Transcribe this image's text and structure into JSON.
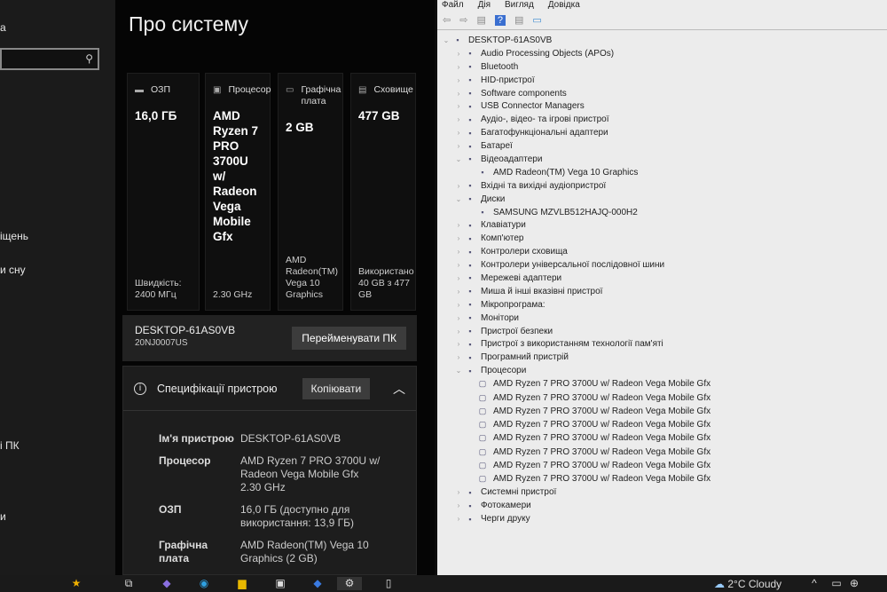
{
  "sidebar": {
    "fragments": [
      "а",
      "іщень",
      "и сну",
      "і ПК",
      "и"
    ],
    "search_icon": "search-icon"
  },
  "settings": {
    "title": "Про систему",
    "cards": [
      {
        "label": "ОЗП",
        "icon": "ram-icon",
        "value": "16,0 ГБ",
        "footer": "Швидкість: 2400 МГц"
      },
      {
        "label": "Процесор",
        "icon": "cpu-icon",
        "value": "AMD Ryzen 7 PRO 3700U w/ Radeon Vega Mobile Gfx",
        "footer": "2.30 GHz"
      },
      {
        "label": "Графічна плата",
        "icon": "gpu-icon",
        "value": "2 GB",
        "footer": "AMD Radeon(TM) Vega 10 Graphics"
      },
      {
        "label": "Сховище",
        "icon": "storage-icon",
        "value": "477 GB",
        "footer": "Використано 40 GB з 477 GB"
      }
    ],
    "device_name": "DESKTOP-61AS0VB",
    "model": "20NJ0007US",
    "rename_label": "Перейменувати ПК",
    "spec_title": "Специфікації пристрою",
    "copy_label": "Копіювати",
    "specs": [
      {
        "key": "Ім'я пристрою",
        "value": "DESKTOP-61AS0VB"
      },
      {
        "key": "Процесор",
        "value": "AMD Ryzen 7 PRO 3700U w/ Radeon Vega Mobile Gfx 2.30 GHz"
      },
      {
        "key": "ОЗП",
        "value": "16,0 ГБ (доступно для використання: 13,9 ГБ)"
      },
      {
        "key": "Графічна плата",
        "value": "AMD Radeon(TM) Vega 10 Graphics (2 GB)"
      }
    ]
  },
  "device_manager": {
    "menu": [
      "Файл",
      "Дія",
      "Вигляд",
      "Довідка"
    ],
    "tree": [
      {
        "label": "DESKTOP-61AS0VB",
        "level": 0,
        "expanded": true
      },
      {
        "label": "Audio Processing Objects (APOs)",
        "level": 1
      },
      {
        "label": "Bluetooth",
        "level": 1
      },
      {
        "label": "HID-пристрої",
        "level": 1
      },
      {
        "label": "Software components",
        "level": 1
      },
      {
        "label": "USB Connector Managers",
        "level": 1
      },
      {
        "label": "Аудіо-, відео- та ігрові пристрої",
        "level": 1
      },
      {
        "label": "Багатофункціональні адаптери",
        "level": 1
      },
      {
        "label": "Батареї",
        "level": 1
      },
      {
        "label": "Відеоадаптери",
        "level": 1,
        "expanded": true
      },
      {
        "label": "AMD Radeon(TM) Vega 10 Graphics",
        "level": 2
      },
      {
        "label": "Вхідні та вихідні аудіопристрої",
        "level": 1
      },
      {
        "label": "Диски",
        "level": 1,
        "expanded": true
      },
      {
        "label": "SAMSUNG MZVLB512HAJQ-000H2",
        "level": 2
      },
      {
        "label": "Клавіатури",
        "level": 1
      },
      {
        "label": "Комп'ютер",
        "level": 1
      },
      {
        "label": "Контролери сховища",
        "level": 1
      },
      {
        "label": "Контролери універсальної послідовної шини",
        "level": 1
      },
      {
        "label": "Мережеві адаптери",
        "level": 1
      },
      {
        "label": "Миша й інші вказівні пристрої",
        "level": 1
      },
      {
        "label": "Мікропрограма:",
        "level": 1
      },
      {
        "label": "Монітори",
        "level": 1
      },
      {
        "label": "Пристрої безпеки",
        "level": 1
      },
      {
        "label": "Пристрої з використанням технології пам'яті",
        "level": 1
      },
      {
        "label": "Програмний пристрій",
        "level": 1
      },
      {
        "label": "Процесори",
        "level": 1,
        "expanded": true
      },
      {
        "label": "AMD Ryzen 7 PRO 3700U w/ Radeon Vega Mobile Gfx",
        "level": 2
      },
      {
        "label": "AMD Ryzen 7 PRO 3700U w/ Radeon Vega Mobile Gfx",
        "level": 2
      },
      {
        "label": "AMD Ryzen 7 PRO 3700U w/ Radeon Vega Mobile Gfx",
        "level": 2
      },
      {
        "label": "AMD Ryzen 7 PRO 3700U w/ Radeon Vega Mobile Gfx",
        "level": 2
      },
      {
        "label": "AMD Ryzen 7 PRO 3700U w/ Radeon Vega Mobile Gfx",
        "level": 2
      },
      {
        "label": "AMD Ryzen 7 PRO 3700U w/ Radeon Vega Mobile Gfx",
        "level": 2
      },
      {
        "label": "AMD Ryzen 7 PRO 3700U w/ Radeon Vega Mobile Gfx",
        "level": 2
      },
      {
        "label": "AMD Ryzen 7 PRO 3700U w/ Radeon Vega Mobile Gfx",
        "level": 2
      },
      {
        "label": "Системні пристрої",
        "level": 1
      },
      {
        "label": "Фотокамери",
        "level": 1
      },
      {
        "label": "Черги друку",
        "level": 1
      }
    ]
  },
  "taskbar": {
    "weather": "2°C Cloudy"
  }
}
